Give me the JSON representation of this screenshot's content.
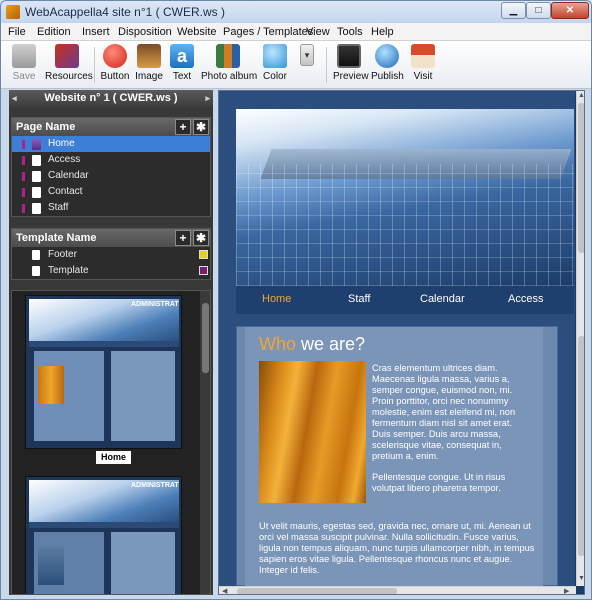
{
  "window": {
    "title": "WebAcappella4 site n°1 ( CWER.ws )",
    "min_label": "▁",
    "max_label": "□",
    "close_label": "✕"
  },
  "menu": [
    "File",
    "Edition",
    "Insert",
    "Disposition",
    "Website",
    "Pages / Templates",
    "View",
    "Tools",
    "Help"
  ],
  "toolbar": {
    "save": "Save",
    "resources": "Resources",
    "button": "Button",
    "image": "Image",
    "text": "Text",
    "photo_album": "Photo album",
    "color": "Color",
    "preview": "Preview",
    "publish": "Publish",
    "visit": "Visit"
  },
  "panel": {
    "title": "Website n° 1 ( CWER.ws )",
    "page_section": "Page Name",
    "pages": [
      "Home",
      "Access",
      "Calendar",
      "Contact",
      "Staff"
    ],
    "template_section": "Template Name",
    "templates": [
      "Footer",
      "Template"
    ],
    "thumb_caption": "Home",
    "thumb_admin": "ADMINISTRAT"
  },
  "site": {
    "nav": [
      "Home",
      "Staff",
      "Calendar",
      "Access"
    ],
    "heading_accent": "Who",
    "heading_rest": " we are?",
    "para1": "Cras elementum ultrices diam. Maecenas ligula massa, varius a, semper congue, euismod non, mi. Proin porttitor, orci nec nonummy molestie, enim est eleifend mi, non fermentum diam nisl sit amet erat. Duis semper. Duis arcu massa, scelerisque vitae, consequat in, pretium a, enim.",
    "para2": "Pellentesque congue. Ut in risus volutpat libero pharetra tempor.",
    "para3": "Ut velit mauris, egestas sed, gravida nec, ornare ut, mi. Aenean ut orci vel massa suscipit pulvinar. Nulla sollicitudin. Fusce varius, ligula non tempus aliquam, nunc turpis ullamcorper nibh, in tempus sapien eros vitae ligula. Pellentesque rhoncus nunc et augue. Integer id felis."
  },
  "colors": {
    "accent": "#f3a530",
    "selected_row": "#3d7fd8",
    "site_bg": "#2c4e7f"
  }
}
